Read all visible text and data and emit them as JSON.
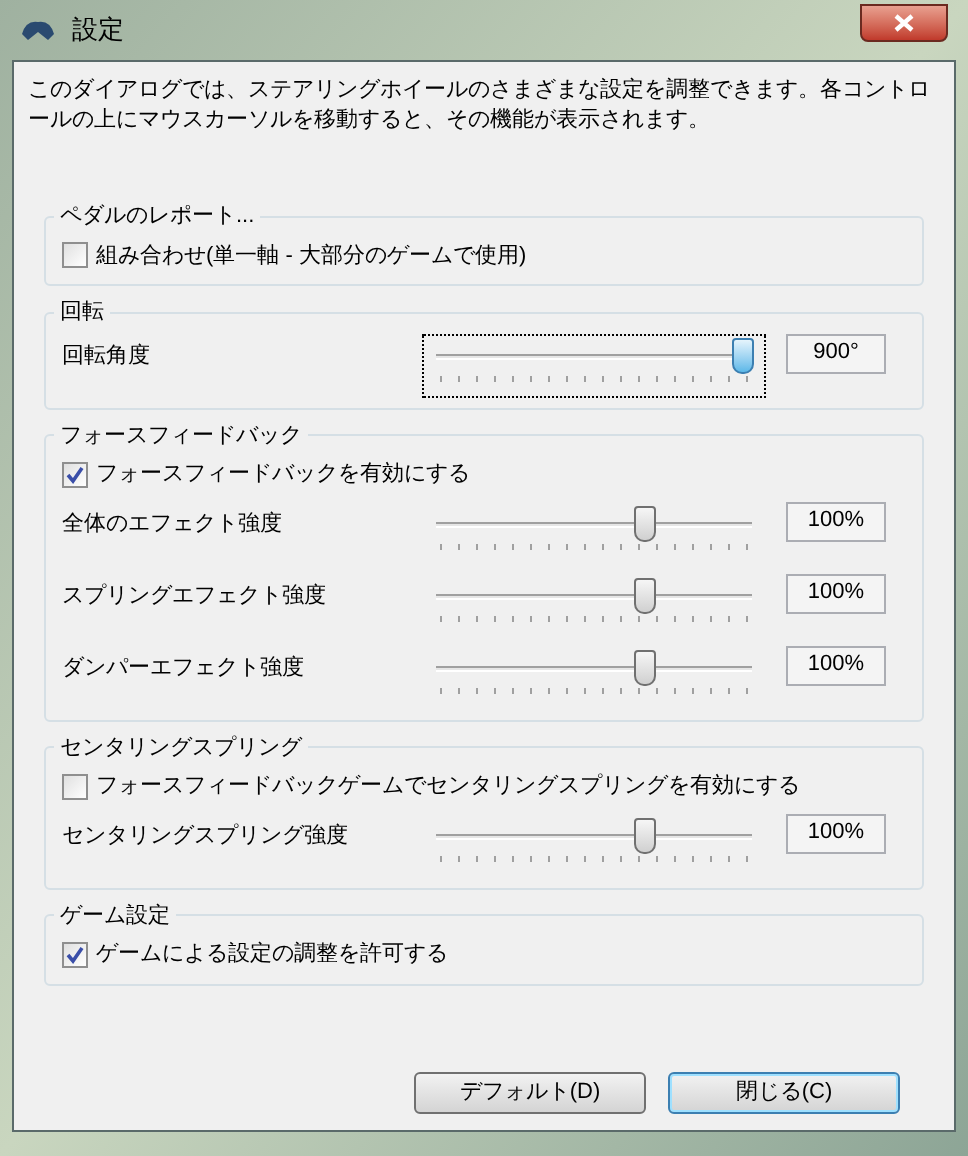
{
  "window": {
    "title": "設定"
  },
  "description": "このダイアログでは、ステアリングホイールのさまざまな設定を調整できます。各コントロールの上にマウスカーソルを移動すると、その機能が表示されます。",
  "groups": [
    {
      "legend": "ペダルのレポート...",
      "items": [
        {
          "kind": "checkbox",
          "label": "組み合わせ(単一軸 - 大部分のゲームで使用)",
          "checked": false
        }
      ]
    },
    {
      "legend": "回転",
      "items": [
        {
          "kind": "slider",
          "label": "回転角度",
          "level": 0.97,
          "reading": "900°",
          "focused": true
        }
      ]
    },
    {
      "legend": "フォースフィードバック",
      "items": [
        {
          "kind": "checkbox",
          "label": "フォースフィードバックを有効にする",
          "checked": true
        },
        {
          "kind": "slider",
          "label": "全体のエフェクト強度",
          "level": 0.66,
          "reading": "100%",
          "focused": false
        },
        {
          "kind": "slider",
          "label": "スプリングエフェクト強度",
          "level": 0.66,
          "reading": "100%",
          "focused": false
        },
        {
          "kind": "slider",
          "label": "ダンパーエフェクト強度",
          "level": 0.66,
          "reading": "100%",
          "focused": false
        }
      ]
    },
    {
      "legend": "センタリングスプリング",
      "items": [
        {
          "kind": "checkbox",
          "label": "フォースフィードバックゲームでセンタリングスプリングを有効にする",
          "checked": false
        },
        {
          "kind": "slider",
          "label": "センタリングスプリング強度",
          "level": 0.66,
          "reading": "100%",
          "focused": false
        }
      ]
    },
    {
      "legend": "ゲーム設定",
      "items": [
        {
          "kind": "checkbox",
          "label": "ゲームによる設定の調整を許可する",
          "checked": true
        }
      ]
    }
  ],
  "buttons": [
    {
      "label": "デフォルト(D)",
      "default": false
    },
    {
      "label": "閉じる(C)",
      "default": true
    }
  ]
}
